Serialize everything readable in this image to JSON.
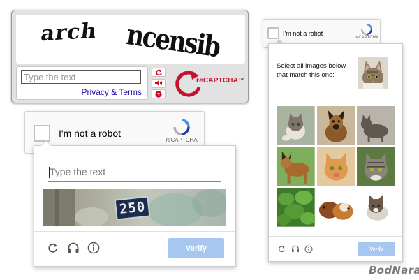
{
  "classic": {
    "captcha_words": [
      "arch",
      "ncensib"
    ],
    "input_placeholder": "Type the text",
    "privacy_link": "Privacy & Terms",
    "tools": [
      "refresh-icon",
      "audio-icon",
      "help-icon"
    ],
    "logo_text": "reCAPTCHA™"
  },
  "widget_large": {
    "label": "I'm not a robot",
    "brand": "reCAPTCHA"
  },
  "text_challenge": {
    "input_placeholder": "Type the text",
    "image_number": "250",
    "footer_icons": [
      "reload-icon",
      "headphones-icon",
      "info-icon"
    ],
    "verify_label": "Verify"
  },
  "widget_small": {
    "label": "I'm not a robot",
    "brand": "reCAPTCHA"
  },
  "image_challenge": {
    "instruction": "Select all images below that match this one:",
    "example": "cat",
    "tiles": [
      "cat",
      "dog",
      "cat",
      "dog",
      "cat",
      "cat",
      "plant",
      "guinea-pigs",
      "cat"
    ],
    "footer_icons": [
      "reload-icon",
      "headphones-icon",
      "info-icon"
    ],
    "verify_label": "Verify"
  },
  "watermark": "BodNara",
  "colors": {
    "recaptcha_blue": "#4a90e2",
    "verify_button": "#a7c7f0",
    "classic_red": "#c8102e",
    "link_blue": "#1a0dab"
  }
}
